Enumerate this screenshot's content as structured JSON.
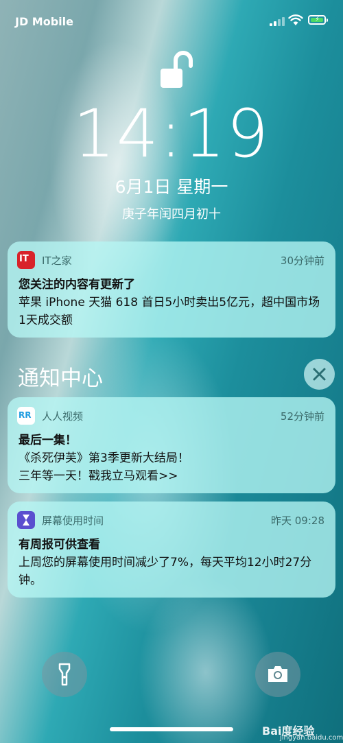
{
  "status": {
    "carrier": "JD Mobile"
  },
  "lock": {
    "time": "14:19",
    "date": "6月1日 星期一",
    "lunar": "庚子年闰四月初十"
  },
  "notifications": [
    {
      "app": "IT之家",
      "when": "30分钟前",
      "title": "您关注的内容有更新了",
      "body": "苹果 iPhone 天猫 618 首日5小时卖出5亿元，超中国市场1天成交额",
      "icon_text": "IT",
      "icon": "ithome-icon"
    },
    {
      "app": "人人视频",
      "when": "52分钟前",
      "title": "最后一集！",
      "body": "《杀死伊芙》第3季更新大结局！\n三年等一天！戳我立马观看>>",
      "icon_text": "RR",
      "icon": "renren-icon"
    },
    {
      "app": "屏幕使用时间",
      "when": "昨天 09:28",
      "title": "有周报可供查看",
      "body": "上周您的屏幕使用时间减少了7%，每天平均12小时27分钟。",
      "icon": "hourglass-icon"
    }
  ],
  "notification_center": {
    "label": "通知中心"
  },
  "watermark": {
    "brand": "Bai度经验",
    "url": "jingyan.baidu.com"
  },
  "colors": {
    "ithome": "#d8232a",
    "renren": "#ffffff",
    "screentime": "#5a4fcf",
    "battery": "#4cd964"
  }
}
